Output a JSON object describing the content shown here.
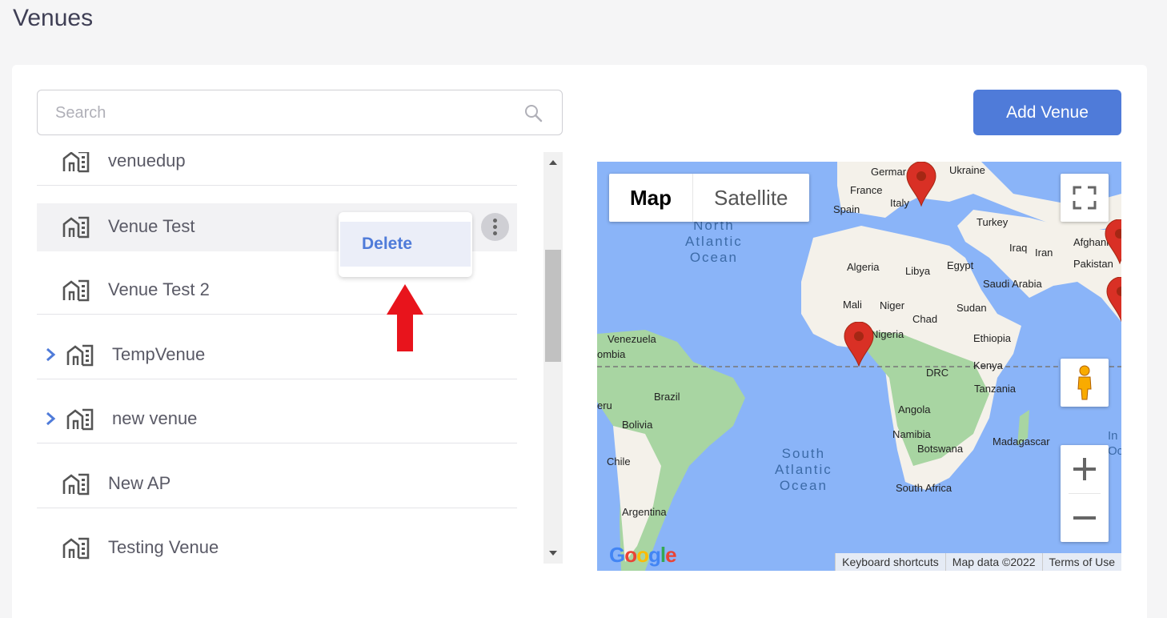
{
  "page": {
    "title": "Venues"
  },
  "search": {
    "placeholder": "Search",
    "icon": "search-icon"
  },
  "toolbar": {
    "add_venue_label": "Add Venue"
  },
  "venues": [
    {
      "name": "venuedup",
      "expandable": false,
      "icon": "building-icon"
    },
    {
      "name": "Venue Test",
      "expandable": false,
      "icon": "building-icon",
      "active": true
    },
    {
      "name": "Venue Test 2",
      "expandable": false,
      "icon": "building-icon"
    },
    {
      "name": "TempVenue",
      "expandable": true,
      "icon": "building-icon"
    },
    {
      "name": "new venue",
      "expandable": true,
      "icon": "building-icon"
    },
    {
      "name": "New AP",
      "expandable": false,
      "icon": "building-icon"
    },
    {
      "name": "Testing Venue",
      "expandable": false,
      "icon": "building-icon"
    }
  ],
  "context_menu": {
    "delete_label": "Delete"
  },
  "map": {
    "type_map_label": "Map",
    "type_satellite_label": "Satellite",
    "keyboard_shortcuts": "Keyboard shortcuts",
    "map_data": "Map data ©2022",
    "terms": "Terms of Use",
    "logo_text": "Google",
    "oceans": {
      "north_atlantic": [
        "North",
        "Atlantic",
        "Ocean"
      ],
      "south_atlantic": [
        "South",
        "Atlantic",
        "Ocean"
      ]
    },
    "labels": {
      "germany": "Germar",
      "ukraine": "Ukraine",
      "france": "France",
      "spain": "Spain",
      "italy": "Italy",
      "turkey": "Turkey",
      "afghanistan": "Afghanist",
      "iraq": "Iraq",
      "iran": "Iran",
      "pakistan": "Pakistan",
      "algeria": "Algeria",
      "libya": "Libya",
      "egypt": "Egypt",
      "saudi": "Saudi Arabia",
      "mali": "Mali",
      "niger": "Niger",
      "sudan": "Sudan",
      "chad": "Chad",
      "nigeria": "Nigeria",
      "ethiopia": "Ethiopia",
      "venezuela": "Venezuela",
      "colombia": "ombia",
      "kenya": "Kenya",
      "drc": "DRC",
      "tanzania": "Tanzania",
      "brazil": "Brazil",
      "peru": "eru",
      "bolivia": "Bolivia",
      "angola": "Angola",
      "namibia": "Namibia",
      "botswana": "Botswana",
      "madagascar": "Madagascar",
      "chile": "Chile",
      "south_africa": "South Africa",
      "argentina": "Argentina",
      "indian": "In",
      "indian2": "Oc"
    }
  },
  "colors": {
    "accent": "#4f7bd9",
    "map_water": "#8ab4f8",
    "land": "#f4f1ea",
    "green": "#a8d5a2",
    "pin": "#d93025",
    "annotation_arrow": "#e8141c"
  }
}
